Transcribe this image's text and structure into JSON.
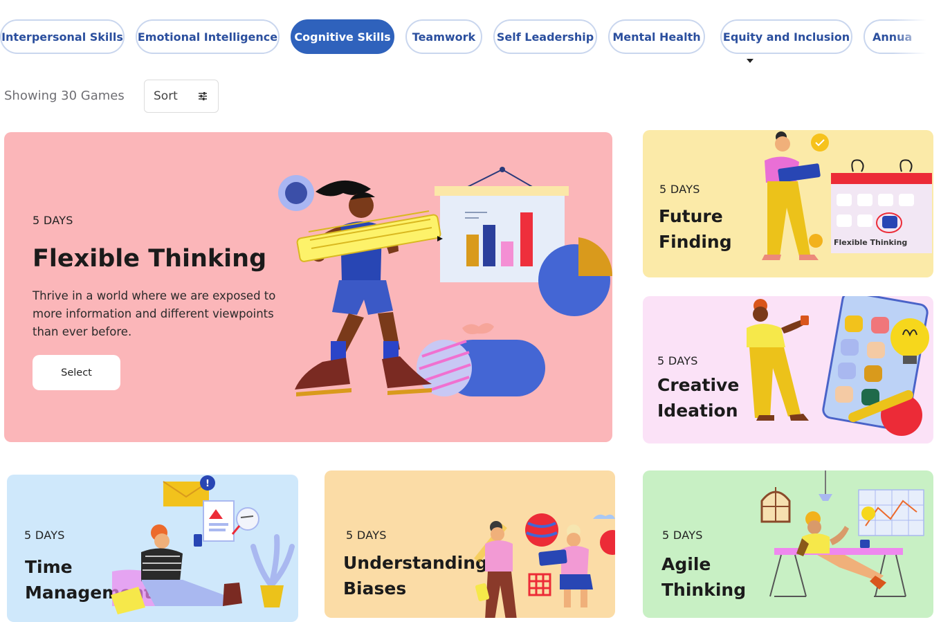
{
  "categories": [
    {
      "label": "Interpersonal Skills",
      "active": false
    },
    {
      "label": "Emotional Intelligence",
      "active": false
    },
    {
      "label": "Cognitive Skills",
      "active": true
    },
    {
      "label": "Teamwork",
      "active": false
    },
    {
      "label": "Self Leadership",
      "active": false
    },
    {
      "label": "Mental Health",
      "active": false
    },
    {
      "label": "Equity and Inclusion",
      "active": false
    },
    {
      "label": "Annua",
      "active": false
    }
  ],
  "toolbar": {
    "showing_text": "Showing 30 Games",
    "sort_label": "Sort"
  },
  "featured": {
    "duration": "5 DAYS",
    "title": "Flexible Thinking",
    "description": "Thrive in a world where we are exposed to more information and different viewpoints than ever before.",
    "select_label": "Select"
  },
  "games": [
    {
      "duration": "5 DAYS",
      "title_line1": "Future",
      "title_line2": "Finding",
      "illustration_caption": "Flexible Thinking"
    },
    {
      "duration": "5 DAYS",
      "title_line1": "Creative",
      "title_line2": "Ideation"
    },
    {
      "duration": "5 DAYS",
      "title_line1": "Time",
      "title_line2": "Management"
    },
    {
      "duration": "5 DAYS",
      "title_line1": "Understanding",
      "title_line2": "Biases"
    },
    {
      "duration": "5 DAYS",
      "title_line1": "Agile",
      "title_line2": "Thinking"
    }
  ],
  "colors": {
    "accent": "#2f62bc",
    "featured_bg": "#fbb6b9",
    "future_bg": "#fbeaa8",
    "creative_bg": "#fbe2f7",
    "time_bg": "#cfe8fb",
    "bias_bg": "#fbdca6",
    "agile_bg": "#c8f0c4"
  },
  "icons": {
    "sort": "sliders-icon",
    "caret": "caret-down-icon"
  }
}
